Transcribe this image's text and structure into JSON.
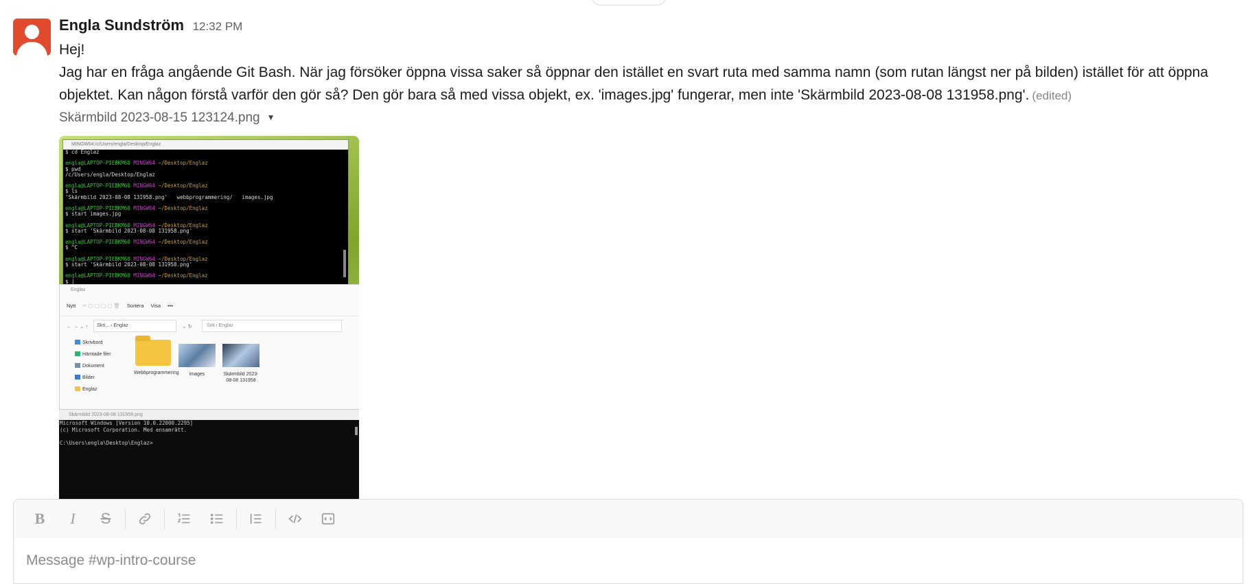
{
  "message": {
    "author": "Engla Sundström",
    "time": "12:32 PM",
    "line1": "Hej!",
    "line2": "Jag har en fråga angående Git Bash. När jag försöker öppna vissa saker så öppnar den istället en svart ruta med samma namn (som rutan längst ner på bilden) istället för att öppna objektet. Kan någon förstå varför den gör så? Den gör bara så med vissa objekt, ex. 'images.jpg' fungerar, men inte 'Skärmbild 2023-08-08 131958.png'.",
    "edited": "(edited)",
    "attachment_name": "Skärmbild 2023-08-15 123124.png"
  },
  "screenshot": {
    "terminal_title": "MINGW64:/c/Users/engla/Desktop/Englaz",
    "terminal_lines": [
      {
        "t": "$ cd Englaz",
        "c": ""
      },
      {
        "t": "",
        "c": ""
      },
      {
        "t": "engla@LAPTOP-PIEBKM60 MINGW64 ~/Desktop/Englaz",
        "c": "prompt"
      },
      {
        "t": "$ pwd",
        "c": ""
      },
      {
        "t": "/c/Users/engla/Desktop/Englaz",
        "c": ""
      },
      {
        "t": "",
        "c": ""
      },
      {
        "t": "engla@LAPTOP-PIEBKM60 MINGW64 ~/Desktop/Englaz",
        "c": "prompt"
      },
      {
        "t": "$ ls",
        "c": ""
      },
      {
        "t": "'Skärmbild 2023-08-08 131958.png'   webbprogrammering/   images.jpg",
        "c": ""
      },
      {
        "t": "",
        "c": ""
      },
      {
        "t": "engla@LAPTOP-PIEBKM60 MINGW64 ~/Desktop/Englaz",
        "c": "prompt"
      },
      {
        "t": "$ start images.jpg",
        "c": ""
      },
      {
        "t": "",
        "c": ""
      },
      {
        "t": "engla@LAPTOP-PIEBKM60 MINGW64 ~/Desktop/Englaz",
        "c": "prompt"
      },
      {
        "t": "$ start 'Skärmbild 2023-08-08 131958.png'",
        "c": ""
      },
      {
        "t": "",
        "c": ""
      },
      {
        "t": "engla@LAPTOP-PIEBKM60 MINGW64 ~/Desktop/Englaz",
        "c": "prompt"
      },
      {
        "t": "$ ^C",
        "c": ""
      },
      {
        "t": "",
        "c": ""
      },
      {
        "t": "engla@LAPTOP-PIEBKM60 MINGW64 ~/Desktop/Englaz",
        "c": "prompt"
      },
      {
        "t": "$ start 'Skärmbild 2023-08-08 131958.png'",
        "c": ""
      },
      {
        "t": "",
        "c": ""
      },
      {
        "t": "engla@LAPTOP-PIEBKM60 MINGW64 ~/Desktop/Englaz",
        "c": "prompt"
      },
      {
        "t": "$ |",
        "c": ""
      }
    ],
    "explorer": {
      "title": "Englaz",
      "toolbar": [
        "Nytt",
        "Sortera",
        "Visa",
        "•••"
      ],
      "address": "Skri...  ›  Englaz",
      "search_placeholder": "Sök i Englaz",
      "nav_items": [
        "Skrivbord",
        "Hämtade filer",
        "Dokument",
        "Bilder",
        "Englaz"
      ],
      "files": [
        "Webbprogrammering",
        "images",
        "Skärmbild 2023-08-08 131958"
      ]
    },
    "cmd_title": "Skärmbild 2023-08-08 131958.png",
    "cmd_lines": [
      "Microsoft Windows [Version 10.0.22000.2295]",
      "(c) Microsoft Corporation. Med ensamrätt.",
      "",
      "C:\\Users\\engla\\Desktop\\Englaz>"
    ]
  },
  "composer": {
    "placeholder": "Message #wp-intro-course",
    "buttons": [
      "bold-icon",
      "italic-icon",
      "strikethrough-icon",
      "link-icon",
      "ordered-list-icon",
      "bulleted-list-icon",
      "blockquote-icon",
      "code-icon",
      "code-block-icon"
    ]
  }
}
